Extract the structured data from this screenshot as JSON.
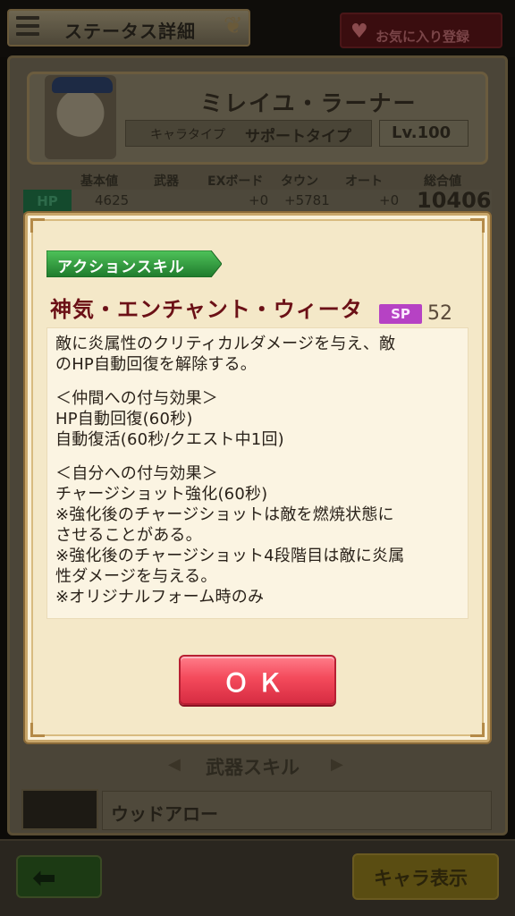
{
  "header": {
    "title": "ステータス詳細",
    "favorite_label": "お気に入り登録"
  },
  "character": {
    "name": "ミレイユ・ラーナー",
    "type_key": "キャラタイプ",
    "type_value": "サポートタイプ",
    "level": "Lv.100"
  },
  "stats": {
    "headers": [
      "基本値",
      "武器",
      "EXボード",
      "タウン",
      "オート",
      "総合値"
    ],
    "hp_label": "HP",
    "hp_values": [
      "4625",
      "",
      "+0",
      "+5781",
      "+0"
    ],
    "hp_total": "10406"
  },
  "dialog": {
    "skill_type": "アクションスキル",
    "skill_name": "神気・エンチャント・ウィータ",
    "sp_label": "SP",
    "sp_value": "52",
    "description_lines": [
      "敵に炎属性のクリティカルダメージを与え、敵",
      "のHP自動回復を解除する。",
      "",
      "＜仲間への付与効果＞",
      "HP自動回復(60秒)",
      "自動復活(60秒/クエスト中1回)",
      "",
      "＜自分への付与効果＞",
      "チャージショット強化(60秒)",
      "※強化後のチャージショットは敵を燃焼状態に",
      "させることがある。",
      "※強化後のチャージショット4段階目は敵に炎属",
      "性ダメージを与える。",
      "※オリジナルフォーム時のみ"
    ],
    "ok_label": "ＯＫ"
  },
  "weapon_section": {
    "title": "武器スキル",
    "weapon_name": "ウッドアロー"
  },
  "footer": {
    "chara_button_label": "キャラ表示"
  },
  "colors": {
    "skill_name": "#6b1016",
    "skill_tag_green": "#2f9a3e",
    "sp_badge": "#b642c4",
    "ok_button": "#f44b5c"
  }
}
